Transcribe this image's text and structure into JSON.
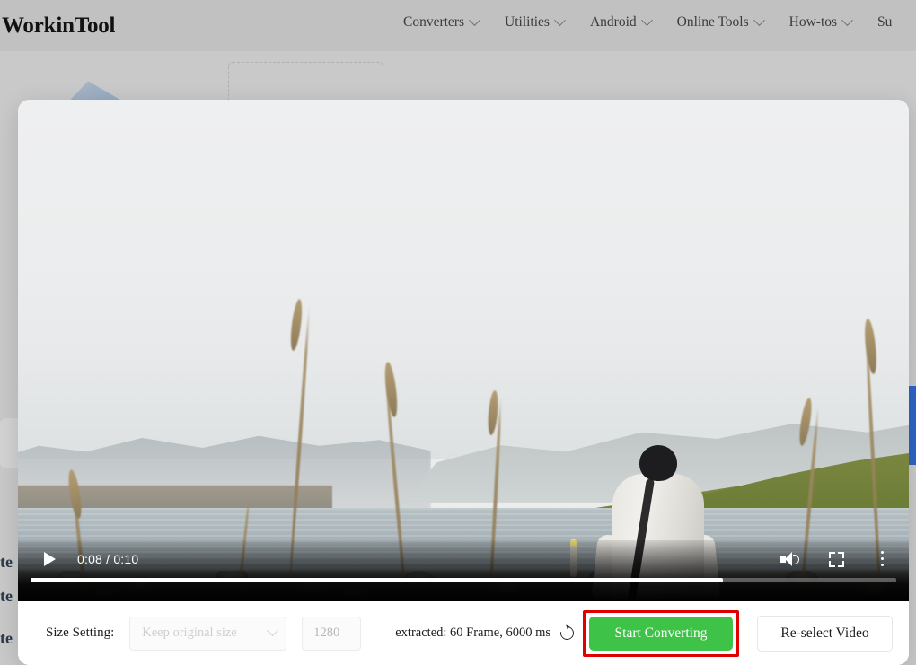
{
  "site": {
    "brand": "WorkinTool",
    "nav": [
      {
        "label": "Converters",
        "icon": "chevron-down-icon"
      },
      {
        "label": "Utilities",
        "icon": "chevron-down-icon"
      },
      {
        "label": "Android",
        "icon": "chevron-down-icon"
      },
      {
        "label": "Online Tools",
        "icon": "chevron-down-icon"
      },
      {
        "label": "How-tos",
        "icon": "chevron-down-icon"
      },
      {
        "label": "Su",
        "icon": "none"
      }
    ],
    "background_fragments": [
      "te",
      "te",
      "te"
    ]
  },
  "modal": {
    "player": {
      "play_icon": "play-icon",
      "time": "0:08 / 0:10",
      "current_time": "0:08",
      "duration": "0:10",
      "progress_percent": 80,
      "volume_icon": "volume-icon",
      "fullscreen_icon": "fullscreen-icon",
      "more_icon": "more-options-icon",
      "scene_description": "Person in white jacket sitting on a rocky riverbank facing green hills"
    },
    "toolbar": {
      "size_setting_label": "Size Setting:",
      "size_select_value": "Keep original size",
      "size_select_placeholder": "Keep original size",
      "size_select_disabled": true,
      "size_select_chevron": "chevron-down-icon",
      "width_input_value": "1280",
      "width_input_placeholder": "1280",
      "width_input_disabled": true,
      "extracted_text": "extracted: 60 Frame, 6000 ms",
      "refresh_icon": "refresh-icon",
      "start_button_label": "Start Converting",
      "reselect_button_label": "Re-select Video"
    }
  },
  "colors": {
    "accent_green": "#3fc248",
    "annotation_red": "#e00000",
    "page_backdrop": "#c9c9c9",
    "modal_bg": "#ffffff",
    "control_bar": "#010101"
  }
}
